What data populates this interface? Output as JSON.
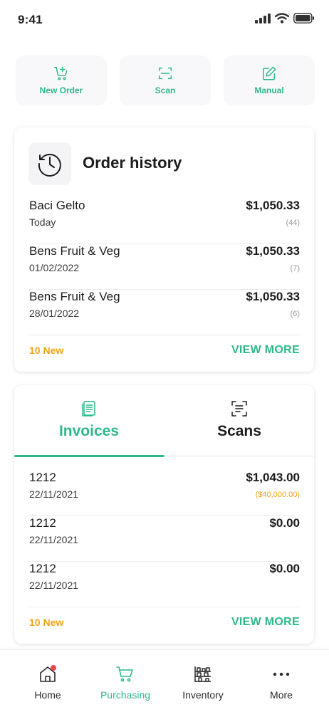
{
  "status": {
    "time": "9:41"
  },
  "quick_actions": [
    {
      "label": "New Order",
      "icon": "cart-plus-icon"
    },
    {
      "label": "Scan",
      "icon": "scan-frame-icon"
    },
    {
      "label": "Manual",
      "icon": "edit-icon"
    }
  ],
  "order_history": {
    "title": "Order history",
    "icon": "history-clock-icon",
    "rows": [
      {
        "name": "Baci Gelto",
        "date": "Today",
        "amount": "$1,050.33",
        "count": "(44)"
      },
      {
        "name": "Bens Fruit & Veg",
        "date": "01/02/2022",
        "amount": "$1,050.33",
        "count": "(7)"
      },
      {
        "name": "Bens Fruit & Veg",
        "date": "28/01/2022",
        "amount": "$1,050.33",
        "count": "(6)"
      }
    ],
    "new_label": "10 New",
    "view_more": "VIEW MORE"
  },
  "documents": {
    "tabs": [
      {
        "label": "Invoices",
        "icon": "invoice-stack-icon",
        "active": true
      },
      {
        "label": "Scans",
        "icon": "scan-document-icon",
        "active": false
      }
    ],
    "rows": [
      {
        "name": "1212",
        "date": "22/11/2021",
        "amount": "$1,043.00",
        "sub": "($40,000.00)"
      },
      {
        "name": "1212",
        "date": "22/11/2021",
        "amount": "$0.00",
        "sub": ""
      },
      {
        "name": "1212",
        "date": "22/11/2021",
        "amount": "$0.00",
        "sub": ""
      }
    ],
    "new_label": "10 New",
    "view_more": "VIEW MORE"
  },
  "bottom_nav": [
    {
      "label": "Home",
      "icon": "home-icon",
      "active": false,
      "badge": true
    },
    {
      "label": "Purchasing",
      "icon": "cart-icon",
      "active": true,
      "badge": false
    },
    {
      "label": "Inventory",
      "icon": "inventory-shelves-icon",
      "active": false,
      "badge": false
    },
    {
      "label": "More",
      "icon": "more-dots-icon",
      "active": false,
      "badge": false
    }
  ],
  "colors": {
    "accent": "#2db88a",
    "warning": "#f5a21a",
    "badge": "#e5484d",
    "text": "#1c1c1c"
  }
}
